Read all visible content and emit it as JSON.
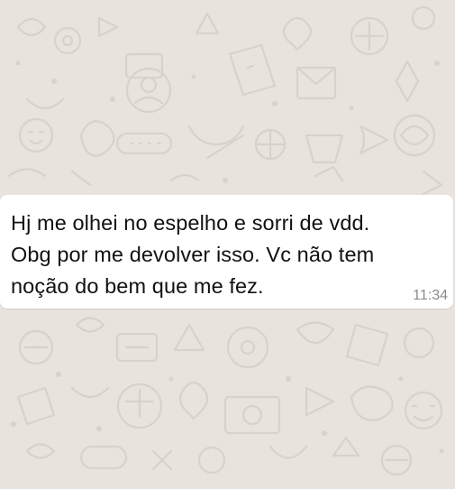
{
  "chat": {
    "background_color": "#e8e3dc",
    "message": {
      "lines": [
        "Hj me olhei no espelho e sorri de vdd.",
        "Obg por me devolver isso. Vc não tem",
        "noção do bem que me fez."
      ],
      "time": "11:34",
      "bubble_color": "#ffffff",
      "text_color": "#111111",
      "time_color": "#8c8c8c"
    }
  }
}
